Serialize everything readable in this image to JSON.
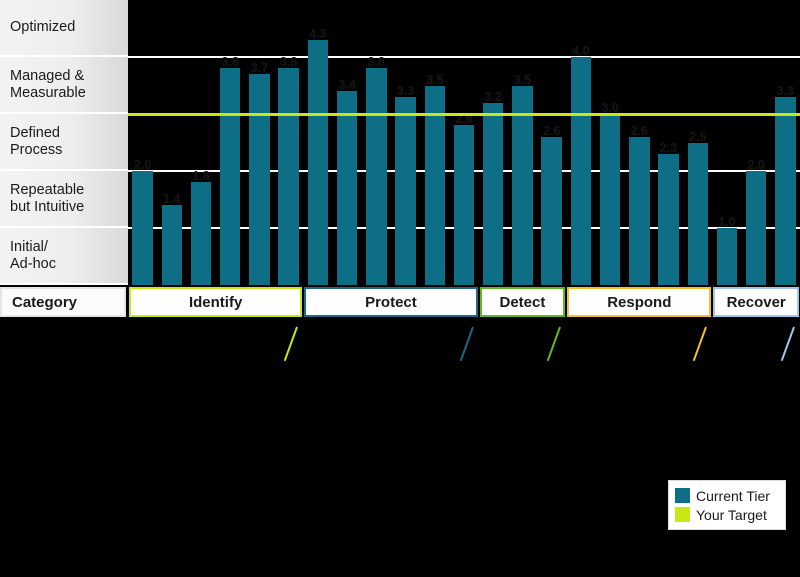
{
  "axis": {
    "title": "Category",
    "tiers": [
      {
        "label": "Optimized",
        "lines": [
          "Optimized"
        ]
      },
      {
        "label": "Managed & Measurable",
        "lines": [
          "Managed &",
          "Measurable"
        ]
      },
      {
        "label": "Defined Process",
        "lines": [
          "Defined",
          "Process"
        ]
      },
      {
        "label": "Repeatable but Intuitive",
        "lines": [
          "Repeatable",
          "but Intuitive"
        ]
      },
      {
        "label": "Initial/ Ad-hoc",
        "lines": [
          "Initial/",
          "Ad-hoc"
        ]
      }
    ]
  },
  "colors": {
    "bar": "#0d6e85",
    "target": "#c8e815",
    "gridline": "#ffffff",
    "background": "#000000",
    "identify": "#c8e815",
    "protect": "#1c6b82",
    "detect": "#5fb91e",
    "respond": "#f4bf2b",
    "recover": "#9fc6e8"
  },
  "legend": {
    "items": [
      {
        "label": "Current Tier",
        "color": "#0d6e85"
      },
      {
        "label": "Your Target",
        "color": "#c8e815"
      }
    ]
  },
  "chart_data": {
    "type": "bar",
    "title": "",
    "xlabel": "Category",
    "ylabel": "",
    "ylim": [
      0,
      5
    ],
    "grid": true,
    "legend_position": "bottom-right",
    "tick_labels": [
      "Initial/ Ad-hoc",
      "Repeatable but Intuitive",
      "Defined Process",
      "Managed & Measurable",
      "Optimized"
    ],
    "target_value": 3.0,
    "target_label": "Your Target",
    "series_name": "Current Tier",
    "categories": [
      "Identify",
      "Protect",
      "Detect",
      "Respond",
      "Recover"
    ],
    "groups": [
      {
        "name": "Identify",
        "accent": "#c8e815",
        "values": [
          2.0,
          1.4,
          1.8,
          3.8,
          3.7,
          3.8
        ]
      },
      {
        "name": "Protect",
        "accent": "#1c6b82",
        "values": [
          4.3,
          3.4,
          3.8,
          3.3,
          3.5,
          2.8
        ]
      },
      {
        "name": "Detect",
        "accent": "#5fb91e",
        "values": [
          3.2,
          3.5,
          2.6
        ]
      },
      {
        "name": "Respond",
        "accent": "#f4bf2b",
        "values": [
          4.0,
          3.0,
          2.6,
          2.3,
          2.5
        ]
      },
      {
        "name": "Recover",
        "accent": "#9fc6e8",
        "values": [
          1.0,
          2.0,
          3.3
        ]
      }
    ],
    "values": [
      2.0,
      1.4,
      1.8,
      3.8,
      3.7,
      3.8,
      4.3,
      3.4,
      3.8,
      3.3,
      3.5,
      2.8,
      3.2,
      3.5,
      2.6,
      4.0,
      3.0,
      2.6,
      2.3,
      2.5,
      1.0,
      2.0,
      3.3
    ]
  }
}
